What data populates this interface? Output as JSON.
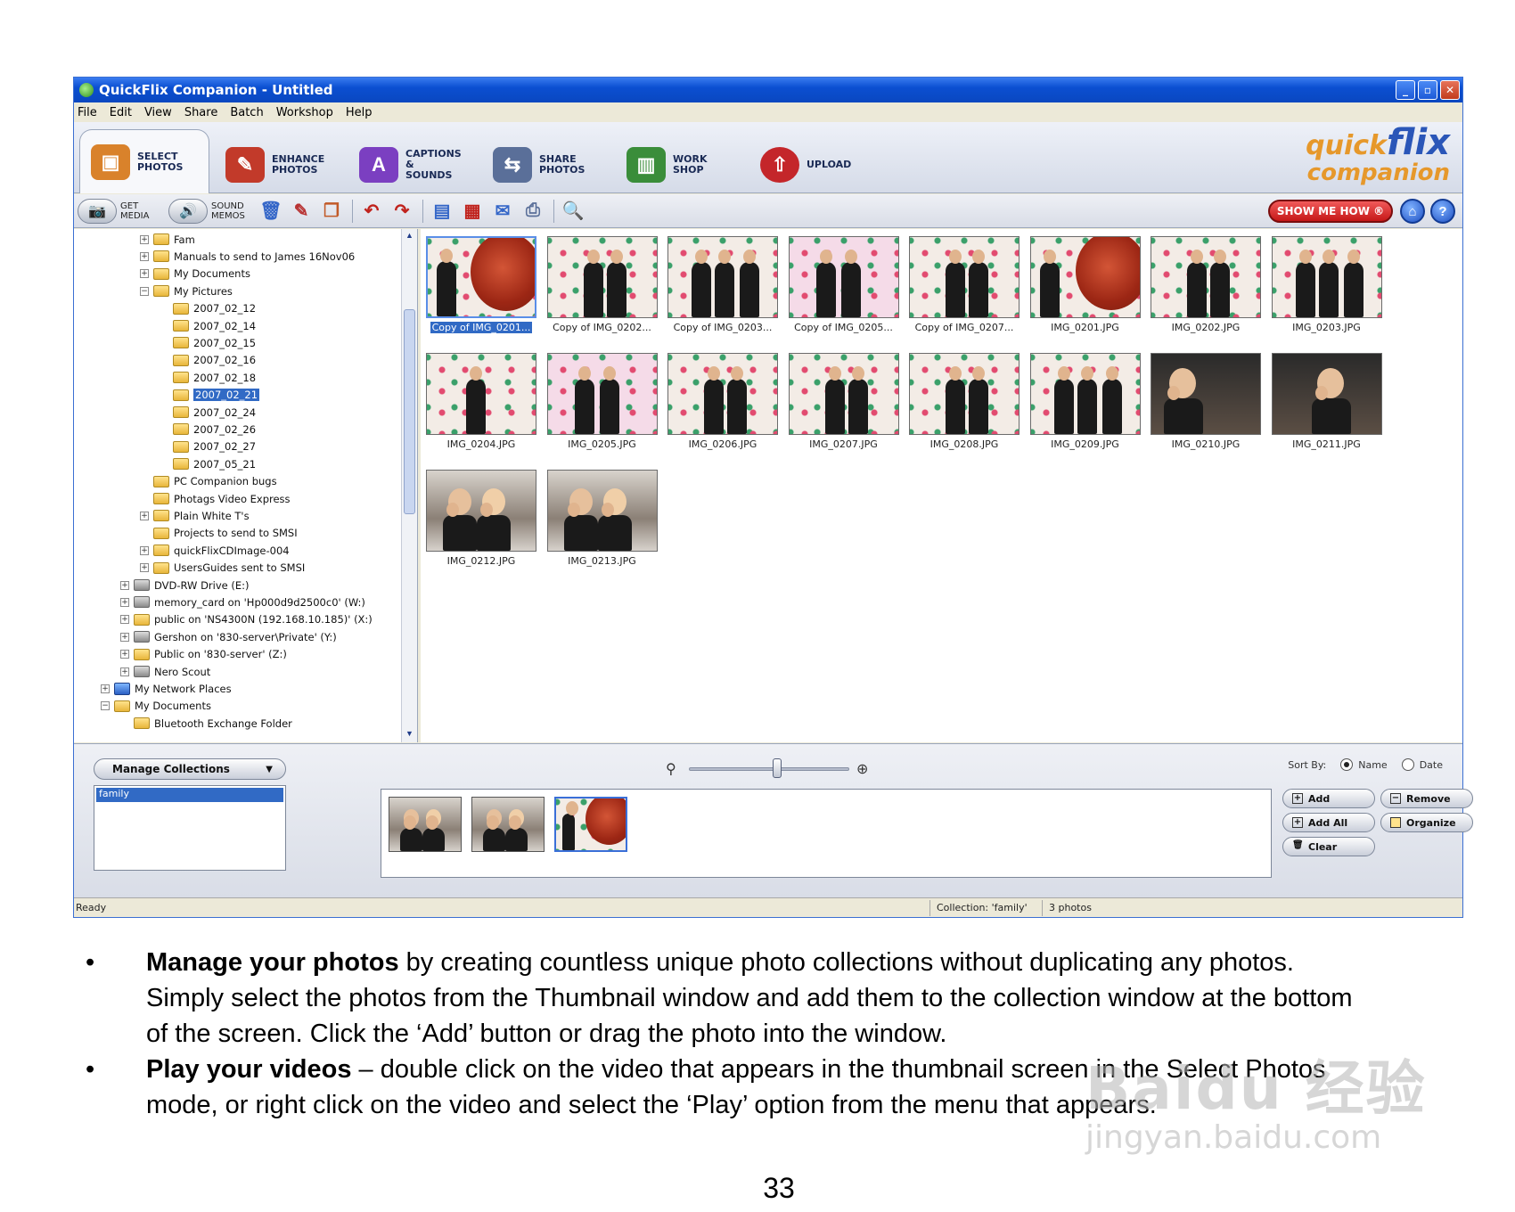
{
  "window": {
    "title": "QuickFlix Companion - Untitled",
    "buttons": [
      "_",
      "▫",
      "✕"
    ]
  },
  "menu": [
    "File",
    "Edit",
    "View",
    "Share",
    "Batch",
    "Workshop",
    "Help"
  ],
  "modes": [
    {
      "label": "SELECT PHOTOS",
      "icon": "select-photos-icon",
      "color": "#d9822b",
      "active": true
    },
    {
      "label": "ENHANCE PHOTOS",
      "icon": "enhance-photos-icon",
      "color": "#c23a2a",
      "active": false
    },
    {
      "label": "CAPTIONS & SOUNDS",
      "icon": "captions-sounds-icon",
      "color": "#7b3fc1",
      "active": false
    },
    {
      "label": "SHARE PHOTOS",
      "icon": "share-photos-icon",
      "color": "#5a6f99",
      "active": false
    },
    {
      "label": "WORK SHOP",
      "icon": "work-shop-icon",
      "color": "#3a8d3a",
      "active": false
    },
    {
      "label": "UPLOAD",
      "icon": "upload-icon",
      "color": "#c4262a",
      "active": false
    }
  ],
  "logo": {
    "line1a": "quick",
    "line1b": "flix",
    "line2": "companion"
  },
  "toolbar": {
    "get_media": "GET MEDIA",
    "sound_memos": "SOUND MEMOS",
    "show_me_how": "SHOW ME HOW ®",
    "home": "⌂",
    "help": "?"
  },
  "tree": [
    {
      "label": "Fam",
      "indent": 3,
      "exp": "+",
      "icon": "folder"
    },
    {
      "label": "Manuals to send to James 16Nov06",
      "indent": 3,
      "exp": "+",
      "icon": "folder"
    },
    {
      "label": "My Documents",
      "indent": 3,
      "exp": "+",
      "icon": "folder"
    },
    {
      "label": "My Pictures",
      "indent": 3,
      "exp": "−",
      "icon": "folder"
    },
    {
      "label": "2007_02_12",
      "indent": 4,
      "exp": "",
      "icon": "folder"
    },
    {
      "label": "2007_02_14",
      "indent": 4,
      "exp": "",
      "icon": "folder"
    },
    {
      "label": "2007_02_15",
      "indent": 4,
      "exp": "",
      "icon": "folder"
    },
    {
      "label": "2007_02_16",
      "indent": 4,
      "exp": "",
      "icon": "folder"
    },
    {
      "label": "2007_02_18",
      "indent": 4,
      "exp": "",
      "icon": "folder"
    },
    {
      "label": "2007_02_21",
      "indent": 4,
      "exp": "",
      "icon": "folder",
      "selected": true
    },
    {
      "label": "2007_02_24",
      "indent": 4,
      "exp": "",
      "icon": "folder"
    },
    {
      "label": "2007_02_26",
      "indent": 4,
      "exp": "",
      "icon": "folder"
    },
    {
      "label": "2007_02_27",
      "indent": 4,
      "exp": "",
      "icon": "folder"
    },
    {
      "label": "2007_05_21",
      "indent": 4,
      "exp": "",
      "icon": "folder"
    },
    {
      "label": "PC Companion bugs",
      "indent": 3,
      "exp": "",
      "icon": "folder"
    },
    {
      "label": "Photags Video Express",
      "indent": 3,
      "exp": "",
      "icon": "folder"
    },
    {
      "label": "Plain White T's",
      "indent": 3,
      "exp": "+",
      "icon": "folder"
    },
    {
      "label": "Projects to send to SMSI",
      "indent": 3,
      "exp": "",
      "icon": "folder"
    },
    {
      "label": "quickFlixCDImage-004",
      "indent": 3,
      "exp": "+",
      "icon": "folder"
    },
    {
      "label": "UsersGuides sent to SMSI",
      "indent": 3,
      "exp": "+",
      "icon": "folder"
    },
    {
      "label": "DVD-RW Drive (E:)",
      "indent": 2,
      "exp": "+",
      "icon": "drive"
    },
    {
      "label": "memory_card on 'Hp000d9d2500c0' (W:)",
      "indent": 2,
      "exp": "+",
      "icon": "drive"
    },
    {
      "label": "public on 'NS4300N (192.168.10.185)' (X:)",
      "indent": 2,
      "exp": "+",
      "icon": "folder"
    },
    {
      "label": "Gershon on '830-server\\Private' (Y:)",
      "indent": 2,
      "exp": "+",
      "icon": "drive"
    },
    {
      "label": "Public on '830-server' (Z:)",
      "indent": 2,
      "exp": "+",
      "icon": "folder"
    },
    {
      "label": "Nero Scout",
      "indent": 2,
      "exp": "+",
      "icon": "drive"
    },
    {
      "label": "My Network Places",
      "indent": 1,
      "exp": "+",
      "icon": "net"
    },
    {
      "label": "My Documents",
      "indent": 1,
      "exp": "−",
      "icon": "folder"
    },
    {
      "label": "Bluetooth Exchange Folder",
      "indent": 2,
      "exp": "",
      "icon": "folder"
    }
  ],
  "thumbnails": [
    {
      "caption": "Copy of IMG_0201...",
      "style": "redhair",
      "selected": true
    },
    {
      "caption": "Copy of IMG_0202...",
      "style": "dots2"
    },
    {
      "caption": "Copy of IMG_0203...",
      "style": "dots3"
    },
    {
      "caption": "Copy of IMG_0205...",
      "style": "pink"
    },
    {
      "caption": "Copy of IMG_0207...",
      "style": "dots2"
    },
    {
      "caption": "IMG_0201.JPG",
      "style": "redhair"
    },
    {
      "caption": "IMG_0202.JPG",
      "style": "dots2"
    },
    {
      "caption": "IMG_0203.JPG",
      "style": "dots3"
    },
    {
      "caption": "IMG_0204.JPG",
      "style": "dots1"
    },
    {
      "caption": "IMG_0205.JPG",
      "style": "pink"
    },
    {
      "caption": "IMG_0206.JPG",
      "style": "dots2"
    },
    {
      "caption": "IMG_0207.JPG",
      "style": "dots2"
    },
    {
      "caption": "IMG_0208.JPG",
      "style": "dots2"
    },
    {
      "caption": "IMG_0209.JPG",
      "style": "dots3"
    },
    {
      "caption": "IMG_0210.JPG",
      "style": "dark"
    },
    {
      "caption": "IMG_0211.JPG",
      "style": "dark2"
    },
    {
      "caption": "IMG_0212.JPG",
      "style": "indoor"
    },
    {
      "caption": "IMG_0213.JPG",
      "style": "indoor"
    }
  ],
  "collections": {
    "manage_label": "Manage Collections",
    "items": [
      "family"
    ],
    "strip": [
      {
        "style": "indoor"
      },
      {
        "style": "indoor"
      },
      {
        "style": "redhair",
        "selected": true
      }
    ],
    "sort_label": "Sort By:",
    "sort_name": "Name",
    "sort_date": "Date",
    "zoom_level": 0.55,
    "buttons": {
      "add": "Add",
      "add_all": "Add All",
      "clear": "Clear",
      "remove": "Remove",
      "organize": "Organize"
    }
  },
  "status": {
    "left": "Ready",
    "collection": "Collection: 'family'",
    "count": "3 photos"
  },
  "document": {
    "bullet1_bold": "Manage your photos",
    "bullet1_rest": " by creating countless unique photo collections without duplicating any photos. Simply select the photos from the Thumbnail window and add them to the collection window at the bottom of the screen. Click the ‘Add’ button or drag the photo into the window.",
    "bullet2_bold": "Play your videos",
    "bullet2_rest": " – double click on the video that appears in the thumbnail screen in the Select Photos mode, or right click on the video and select the ‘Play’ option from the menu that appears.",
    "page_number": "33"
  },
  "watermark": {
    "line1": "Baidu 经验",
    "line2": "jingyan.baidu.com"
  }
}
